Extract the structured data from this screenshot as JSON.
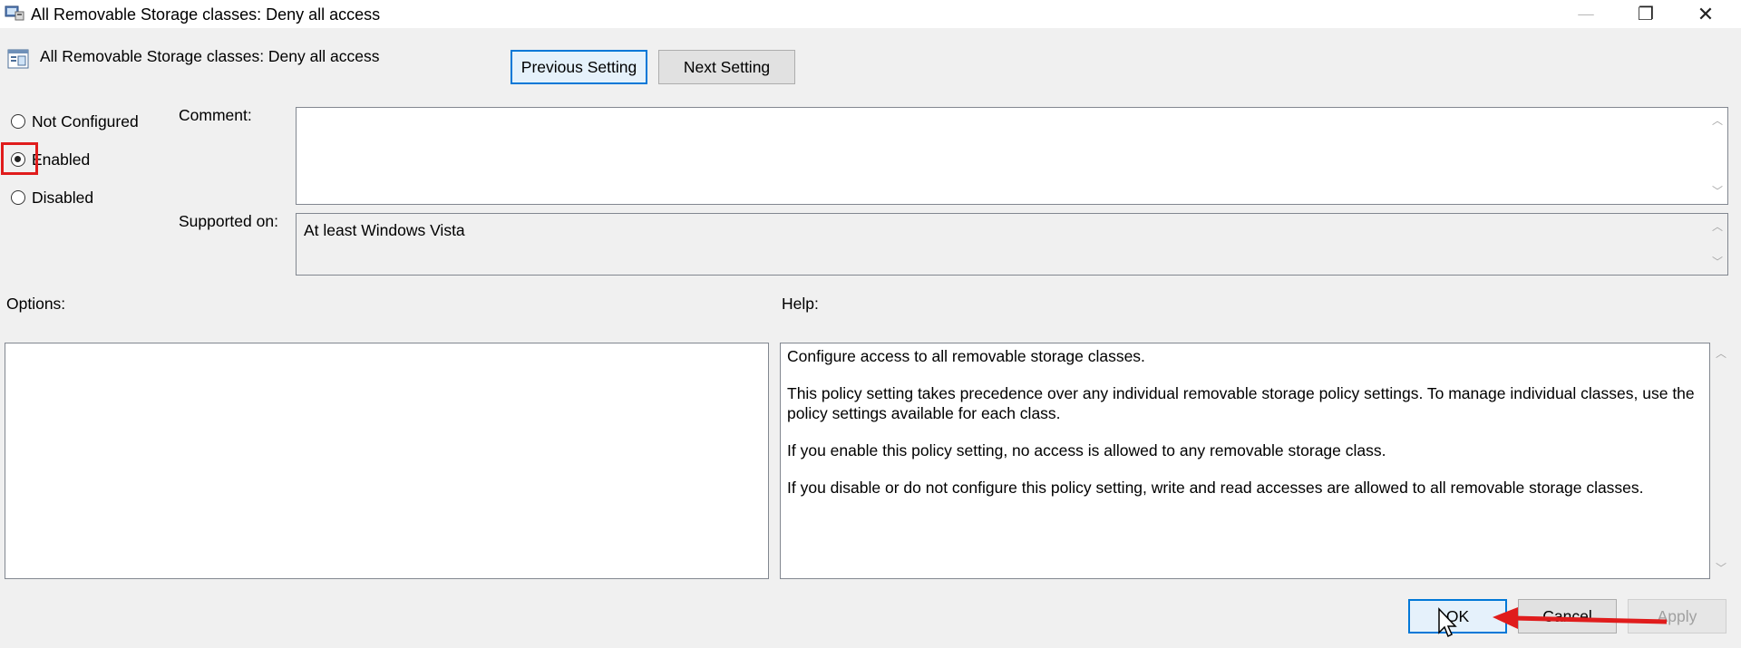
{
  "window": {
    "title": "All Removable Storage classes: Deny all access",
    "controls": {
      "minimize": "—",
      "maximize": "❐",
      "close": "✕"
    }
  },
  "header": {
    "policy_name": "All Removable Storage classes: Deny all access",
    "previous_label": "Previous Setting",
    "next_label": "Next Setting"
  },
  "state": {
    "options": [
      {
        "label": "Not Configured",
        "checked": false
      },
      {
        "label": "Enabled",
        "checked": true
      },
      {
        "label": "Disabled",
        "checked": false
      }
    ]
  },
  "comment": {
    "label": "Comment:",
    "value": ""
  },
  "supported": {
    "label": "Supported on:",
    "value": "At least Windows Vista"
  },
  "options_panel": {
    "label": "Options:"
  },
  "help": {
    "label": "Help:",
    "paragraphs": [
      "Configure access to all removable storage classes.",
      "This policy setting takes precedence over any individual removable storage policy settings. To manage individual classes, use the policy settings available for each class.",
      "If you enable this policy setting, no access is allowed to any removable storage class.",
      "If you disable or do not configure this policy setting, write and read accesses are allowed to all removable storage classes."
    ]
  },
  "footer": {
    "ok_label": "OK",
    "cancel_label": "Cancel",
    "apply_label": "Apply"
  },
  "colors": {
    "accent": "#0078d7",
    "annotation": "#e01c1c"
  }
}
